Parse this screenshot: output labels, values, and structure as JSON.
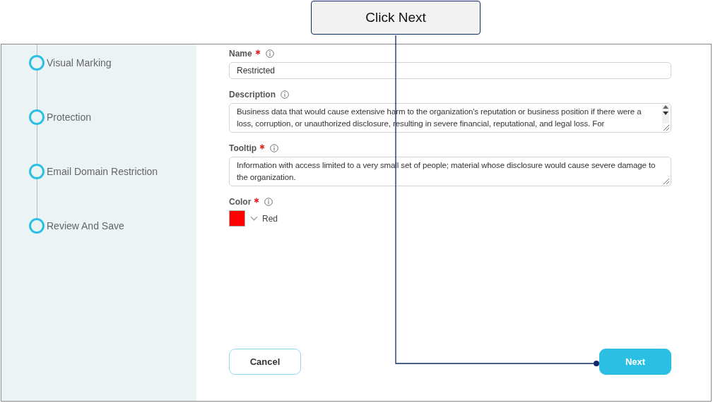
{
  "callout": {
    "text": "Click Next"
  },
  "steps": [
    {
      "label": "Visual Marking"
    },
    {
      "label": "Protection"
    },
    {
      "label": "Email Domain Restriction"
    },
    {
      "label": "Review And Save"
    }
  ],
  "fields": [
    {
      "kind": "input",
      "label": "Name",
      "required": true,
      "value": "Restricted"
    },
    {
      "kind": "textarea",
      "label": "Description",
      "required": false,
      "scrollbar": true,
      "value": "Business data that would cause extensive harm to the organization's reputation or business position if there were a loss, corruption, or unauthorized disclosure, resulting in severe financial, reputational, and legal loss. For"
    },
    {
      "kind": "textarea",
      "label": "Tooltip",
      "required": true,
      "scrollbar": false,
      "value": "Information with access limited to a very small set of people; material whose disclosure would cause severe damage to the organization."
    },
    {
      "kind": "color",
      "label": "Color",
      "required": true,
      "color": "#ff0000",
      "value": "Red"
    }
  ],
  "buttons": [
    {
      "label": "Cancel",
      "kind": "secondary"
    },
    {
      "label": "Next",
      "kind": "primary"
    }
  ]
}
